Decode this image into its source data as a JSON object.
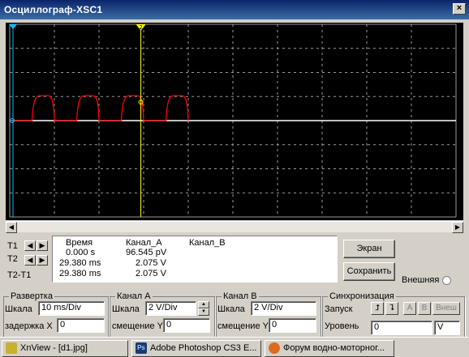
{
  "window": {
    "title": "Осциллограф-XSC1",
    "close_label": "×"
  },
  "cursors": {
    "t1_label": "T1",
    "t2_label": "T2",
    "diff_label": "T2-T1",
    "marker_t1": "1",
    "marker_t2": "2"
  },
  "readout": {
    "headers": {
      "time": "Время",
      "ch_a": "Канал_A",
      "ch_b": "Канал_B"
    },
    "rows": [
      {
        "time": "0.000 s",
        "ch_a": "96.545 pV"
      },
      {
        "time": "29.380 ms",
        "ch_a": "2.075 V"
      },
      {
        "time": "29.380 ms",
        "ch_a": "2.075 V"
      }
    ]
  },
  "buttons": {
    "screen": "Экран",
    "save": "Сохранить",
    "external": "Внешняя"
  },
  "timebase": {
    "title": "Развертка",
    "scale_label": "Шкала",
    "scale_value": "10 ms/Div",
    "delay_label": "задержка X",
    "delay_value": "0"
  },
  "channel_a": {
    "title": "Канал А",
    "scale_label": "Шкала",
    "scale_value": "2  V/Div",
    "offset_label": "смещение Y",
    "offset_value": "0"
  },
  "channel_b": {
    "title": "Канал В",
    "scale_label": "Шкала",
    "scale_value": "2  V/Div",
    "offset_label": "смещение Y",
    "offset_value": "0"
  },
  "sync": {
    "title": "Синхронизация",
    "trigger_label": "Запуск",
    "level_label": "Уровень",
    "level_value": "0",
    "level_unit": "V",
    "src_a": "A",
    "src_b": "B",
    "src_ext": "Внеш"
  },
  "waveform": {
    "channel_a_color": "#ff0000",
    "channel_b_color": "#ffffff",
    "trace_dc_level_volts": 0,
    "pulse_starts_ms": [
      5,
      15,
      25,
      35
    ],
    "pulse_width_ms": 5,
    "pulse_peak_volts": 2.075
  },
  "taskbar": {
    "items": [
      {
        "label": "XnView - [d1.jpg]",
        "icon": "xnview-icon"
      },
      {
        "label": "Adobe Photoshop CS3 E...",
        "icon": "photoshop-icon"
      },
      {
        "label": "Форум водно-моторног...",
        "icon": "firefox-icon"
      }
    ]
  }
}
